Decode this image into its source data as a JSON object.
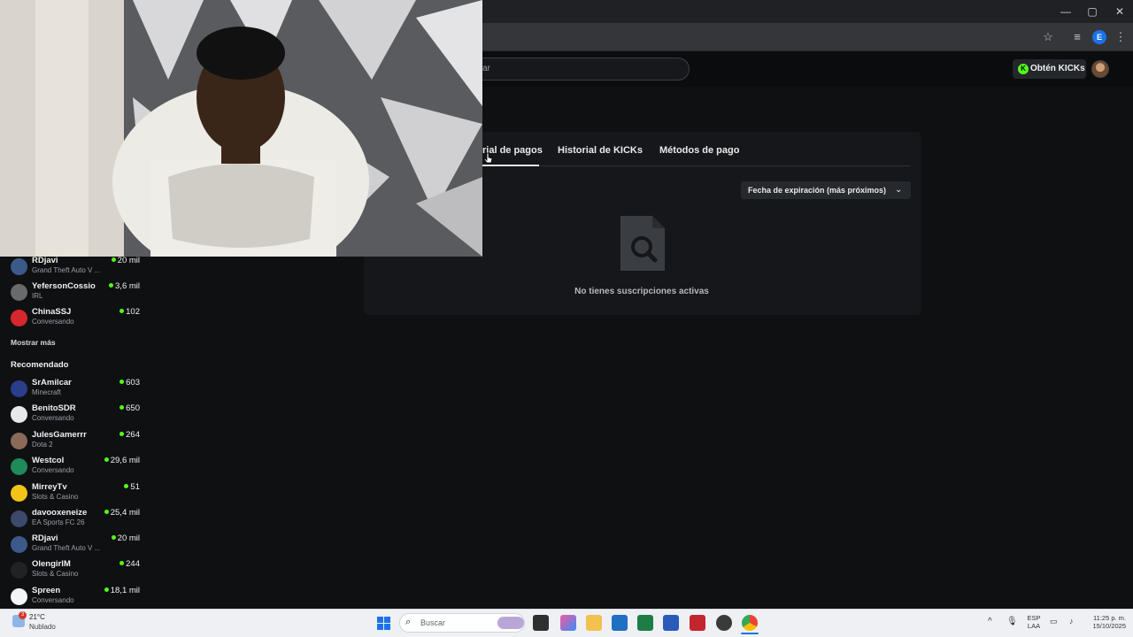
{
  "browser": {
    "window_controls": {
      "minimize": "—",
      "maximize": "▢",
      "close": "✕"
    },
    "profile_initial": "E"
  },
  "header": {
    "search_placeholder": "ar",
    "kicks_button": "Obtén KICKs"
  },
  "tabs": [
    {
      "label": "rial de pagos",
      "active": true
    },
    {
      "label": "Historial de KICKs",
      "active": false
    },
    {
      "label": "Métodos de pago",
      "active": false
    }
  ],
  "sort": {
    "label": "Fecha de expiración (más próximos)"
  },
  "empty_state": {
    "message": "No tienes suscripciones activas"
  },
  "sidebar": {
    "following": [
      {
        "name": "RDjavi",
        "category": "Grand Theft Auto V ...",
        "viewers": "20 mil",
        "color": "#3b5a8a"
      },
      {
        "name": "YefersonCossio",
        "category": "IRL",
        "viewers": "3,6 mil",
        "color": "#6a6a6a"
      },
      {
        "name": "ChinaSSJ",
        "category": "Conversando",
        "viewers": "102",
        "color": "#d6262e"
      }
    ],
    "show_more": "Mostrar más",
    "recommended_heading": "Recomendado",
    "recommended": [
      {
        "name": "SrAmilcar",
        "category": "Minecraft",
        "viewers": "603",
        "color": "#2b3e8c"
      },
      {
        "name": "BenitoSDR",
        "category": "Conversando",
        "viewers": "650",
        "color": "#e8e8e8"
      },
      {
        "name": "JulesGamerrr",
        "category": "Dota 2",
        "viewers": "264",
        "color": "#8a6a58"
      },
      {
        "name": "Westcol",
        "category": "Conversando",
        "viewers": "29,6 mil",
        "color": "#1f8a5a"
      },
      {
        "name": "MirreyTv",
        "category": "Slots & Casino",
        "viewers": "51",
        "color": "#f2c418"
      },
      {
        "name": "davooxeneize",
        "category": "EA Sports FC 26",
        "viewers": "25,4 mil",
        "color": "#3b4a6a"
      },
      {
        "name": "RDjavi",
        "category": "Grand Theft Auto V ...",
        "viewers": "20 mil",
        "color": "#3b5a8a"
      },
      {
        "name": "OlengirlM",
        "category": "Slots & Casino",
        "viewers": "244",
        "color": "#222222"
      },
      {
        "name": "Spreen",
        "category": "Conversando",
        "viewers": "18,1 mil",
        "color": "#f5f5f5"
      }
    ]
  },
  "taskbar": {
    "weather_temp": "21°C",
    "weather_desc": "Nublado",
    "weather_badge": "3",
    "search_label": "Buscar",
    "lang_top": "ESP",
    "lang_bottom": "LAA",
    "time": "11:25 p. m.",
    "date": "15/10/2025"
  },
  "colors": {
    "accent": "#53fc18",
    "background": "#0e1012",
    "panel": "#15171a"
  }
}
